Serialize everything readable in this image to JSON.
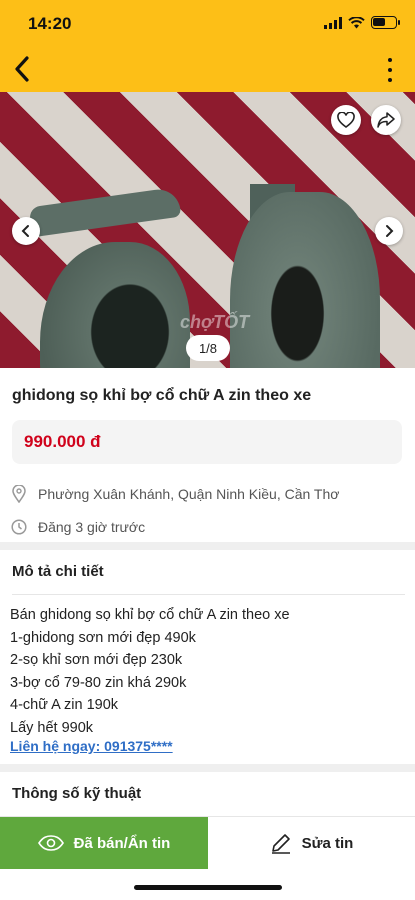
{
  "status_bar": {
    "time": "14:20",
    "battery_level": 0.6
  },
  "header": {
    "back_icon": "chevron-left-icon",
    "more_icon": "vertical-dots-icon",
    "background": "#fdbf17"
  },
  "gallery": {
    "counter": "1/8",
    "watermark": "chợTỐT",
    "icons": [
      "heart-icon",
      "share-icon",
      "chevron-left-icon",
      "chevron-right-icon"
    ]
  },
  "listing": {
    "title": "ghidong sọ khỉ bợ cổ chữ A zin theo xe",
    "price": "990.000 đ",
    "location": "Phường Xuân Khánh, Quận Ninh Kiều, Cần Thơ",
    "posted": "Đăng 3 giờ trước"
  },
  "description": {
    "heading": "Mô tả chi tiết",
    "lines": [
      "Bán ghidong sọ khỉ bợ cổ chữ A zin theo xe",
      "1-ghidong sơn mới đẹp 490k",
      "2-sọ khỉ sơn mới đẹp 230k",
      "3-bợ cổ 79-80 zin khá 290k",
      "4-chữ A zin 190k",
      "Lấy hết 990k"
    ],
    "contact": "Liên hệ ngay: 091375****"
  },
  "specs": {
    "heading": "Thông số kỹ thuật"
  },
  "actions": {
    "sold_label": "Đã bán/Ẩn tin",
    "edit_label": "Sửa tin",
    "sold_color": "#5fa83d"
  },
  "colors": {
    "price": "#d0021b",
    "link": "#2f6ec6"
  }
}
